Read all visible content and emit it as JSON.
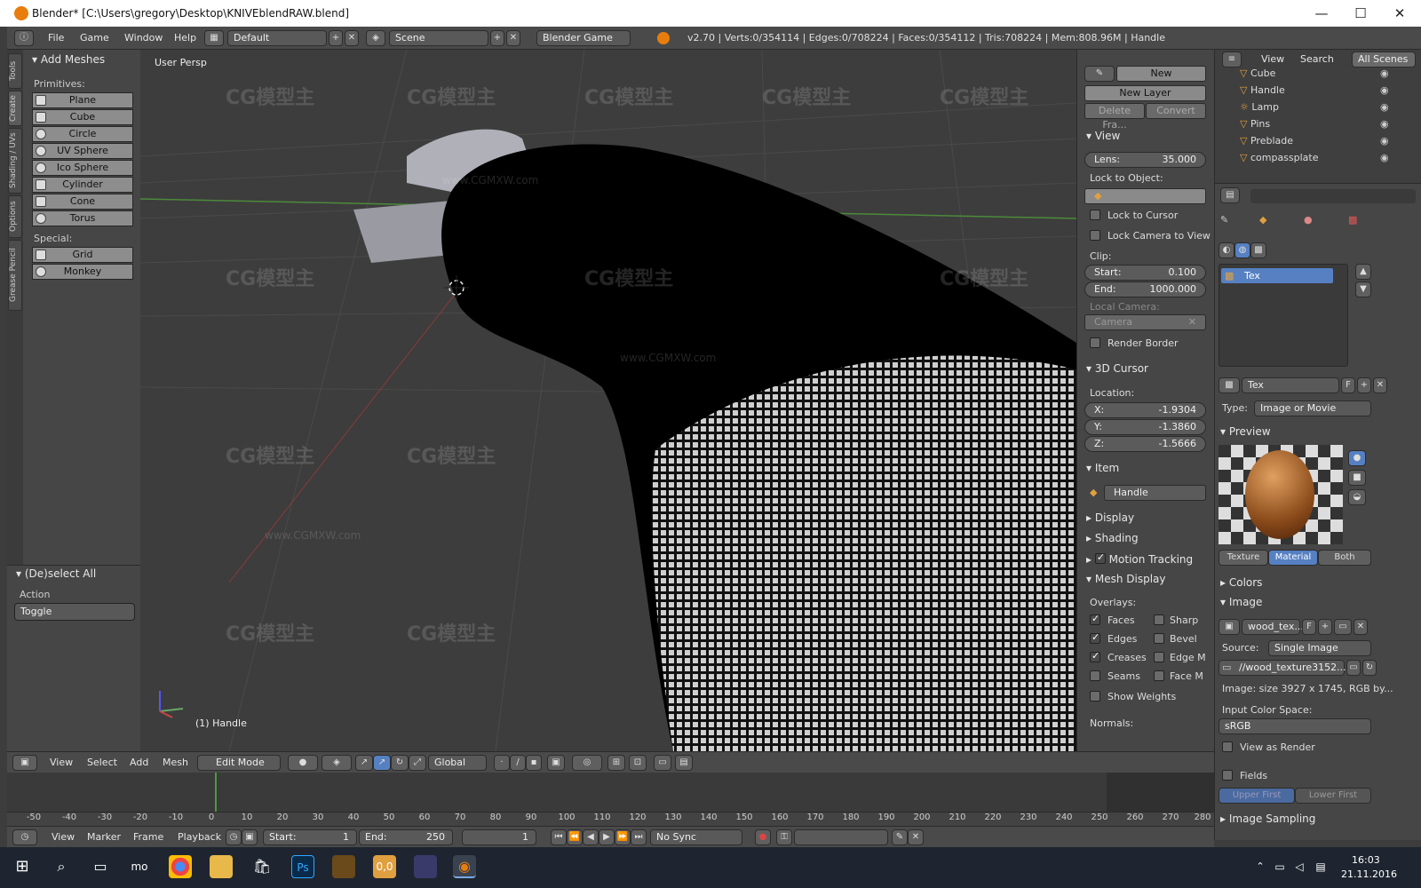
{
  "window": {
    "title": "Blender* [C:\\Users\\gregory\\Desktop\\KNIVEblendRAW.blend]"
  },
  "info_header": {
    "menus": [
      "File",
      "Game",
      "Window",
      "Help"
    ],
    "layout": "Default",
    "scene": "Scene",
    "engine": "Blender Game",
    "stats": "v2.70 | Verts:0/354114 | Edges:0/708224 | Faces:0/354112 | Tris:708224 | Mem:808.96M | Handle"
  },
  "left_tabs": [
    "Tools",
    "Create",
    "Shading / UVs",
    "Options",
    "Grease Pencil"
  ],
  "tool_panel": {
    "section_title": "Add Meshes",
    "primitives_label": "Primitives:",
    "primitives": [
      "Plane",
      "Cube",
      "Circle",
      "UV Sphere",
      "Ico Sphere",
      "Cylinder",
      "Cone",
      "Torus"
    ],
    "special_label": "Special:",
    "special": [
      "Grid",
      "Monkey"
    ]
  },
  "operator_panel": {
    "title": "(De)select All",
    "action_label": "Action",
    "action_value": "Toggle"
  },
  "viewport": {
    "label": "User Persp",
    "object_label": "(1) Handle",
    "watermark": "CG模型主",
    "watermark_url": "www.CGMXW.com"
  },
  "n_panel": {
    "new_label": "New",
    "new_layer_label": "New Layer",
    "delete_frame_label": "Delete Fra...",
    "convert_label": "Convert",
    "view_title": "View",
    "lens_label": "Lens:",
    "lens_value": "35.000",
    "lock_to_object_label": "Lock to Object:",
    "lock_to_cursor_label": "Lock to Cursor",
    "lock_camera_label": "Lock Camera to View",
    "clip_label": "Clip:",
    "clip_start_label": "Start:",
    "clip_start_value": "0.100",
    "clip_end_label": "End:",
    "clip_end_value": "1000.000",
    "local_camera_label": "Local Camera:",
    "camera_value": "Camera",
    "render_border_label": "Render Border",
    "cursor_title": "3D Cursor",
    "location_label": "Location:",
    "cursor_x_label": "X:",
    "cursor_x": "-1.9304",
    "cursor_y_label": "Y:",
    "cursor_y": "-1.3860",
    "cursor_z_label": "Z:",
    "cursor_z": "-1.5666",
    "item_title": "Item",
    "item_name": "Handle",
    "display_title": "Display",
    "shading_title": "Shading",
    "motion_tracking_title": "Motion Tracking",
    "mesh_display_title": "Mesh Display",
    "overlays_label": "Overlays:",
    "overlays_left": [
      "Faces",
      "Edges",
      "Creases",
      "Seams"
    ],
    "overlays_right": [
      "Sharp",
      "Bevel",
      "Edge M",
      "Face M"
    ],
    "show_weights_label": "Show Weights",
    "normals_label": "Normals:"
  },
  "outliner": {
    "menus": [
      "View",
      "Search"
    ],
    "filter": "All Scenes",
    "objects": [
      "Cube",
      "Handle",
      "Lamp",
      "Pins",
      "Preblade",
      "compassplate"
    ]
  },
  "properties": {
    "texture_slot": "Tex",
    "texture_name": "Tex",
    "texture_type_label": "Type:",
    "texture_type": "Image or Movie",
    "preview_title": "Preview",
    "preview_tabs": [
      "Texture",
      "Material",
      "Both"
    ],
    "colors_title": "Colors",
    "image_title": "Image",
    "image_name": "wood_tex...",
    "source_label": "Source:",
    "source_value": "Single Image",
    "filepath": "//wood_texture3152...",
    "image_info": "Image: size 3927 x 1745, RGB by...",
    "input_color_space_label": "Input Color Space:",
    "color_space": "sRGB",
    "view_as_render_label": "View as Render",
    "fields_label": "Fields",
    "upper_first_label": "Upper First",
    "lower_first_label": "Lower First",
    "image_sampling_title": "Image Sampling"
  },
  "toolbar3d": {
    "menus": [
      "View",
      "Select",
      "Add",
      "Mesh"
    ],
    "mode": "Edit Mode",
    "orientation": "Global"
  },
  "timeline": {
    "ticks": [
      "-50",
      "-40",
      "-30",
      "-20",
      "-10",
      "0",
      "10",
      "20",
      "30",
      "40",
      "50",
      "60",
      "70",
      "80",
      "90",
      "100",
      "110",
      "120",
      "130",
      "140",
      "150",
      "160",
      "170",
      "180",
      "190",
      "200",
      "210",
      "220",
      "230",
      "240",
      "250",
      "260",
      "270",
      "280"
    ],
    "menus": [
      "View",
      "Marker",
      "Frame",
      "Playback"
    ],
    "start_label": "Start:",
    "start_value": "1",
    "end_label": "End:",
    "end_value": "250",
    "current_frame": "1",
    "sync": "No Sync"
  },
  "taskbar": {
    "time": "16:03",
    "date": "21.11.2016",
    "app_labels": [
      "mo",
      "Ps",
      "0,0"
    ]
  },
  "colors": {
    "accent_blue": "#5680c2",
    "blender_orange": "#e87d0d",
    "panel_bg": "#464646"
  }
}
